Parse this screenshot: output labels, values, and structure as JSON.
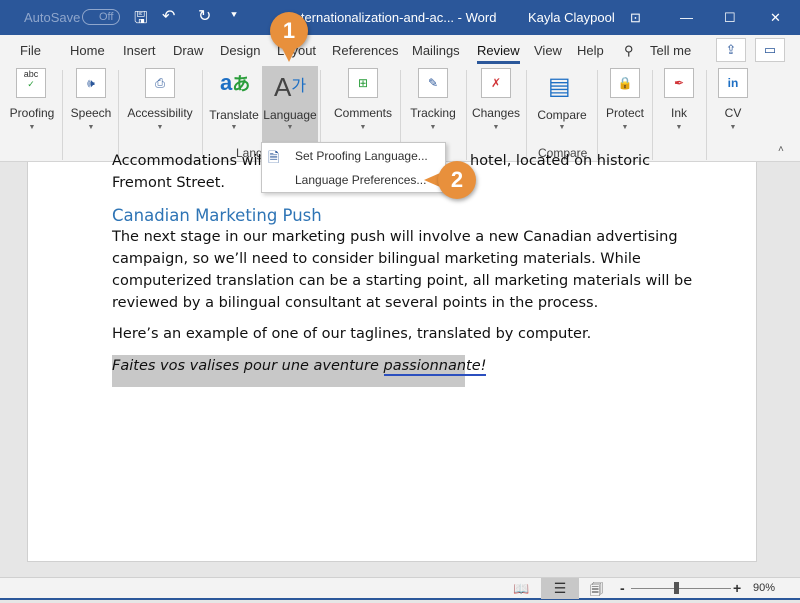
{
  "titlebar": {
    "autosave": "AutoSave",
    "toggle": "Off",
    "doc_title": "Internationalization-and-ac... - Word",
    "user": "Kayla Claypool"
  },
  "tabs": [
    "File",
    "Home",
    "Insert",
    "Draw",
    "Design",
    "Layout",
    "References",
    "Mailings",
    "Review",
    "View",
    "Help"
  ],
  "active_tab": "Review",
  "tell_me": "Tell me",
  "ribbon": {
    "buttons": [
      "Proofing",
      "Speech",
      "Accessibility",
      "Translate",
      "Language",
      "Comments",
      "Tracking",
      "Changes",
      "Compare",
      "Protect",
      "Ink",
      "CV"
    ],
    "groups": {
      "language": "Language",
      "compare": "Compare"
    }
  },
  "menu": {
    "items": [
      "Set Proofing Language...",
      "Language Preferences..."
    ]
  },
  "callouts": [
    "1",
    "2"
  ],
  "document": {
    "line0_left": "Accommodations will",
    "line0_right": "hotel, located on historic",
    "line1": "Fremont Street.",
    "heading": "Canadian Marketing Push",
    "para": [
      "The next stage in our marketing push will involve a new Canadian advertising",
      "campaign, so we’ll need to consider bilingual marketing materials. While",
      "computerized translation can be a starting point, all marketing materials will be",
      "reviewed by a bilingual consultant at several points in the process."
    ],
    "para2": "Here’s an example of one of our taglines, translated by computer.",
    "tagline_a": "Faites vos valises pour une aventure ",
    "tagline_b": "passionnante!"
  },
  "status": {
    "zoom": "90%",
    "zoom_minus": "-",
    "zoom_plus": "+"
  },
  "colors": {
    "titlebar": "#2b579a",
    "heading": "#2e74b5",
    "callout": "#e8903c",
    "highlight": "#c8c8c8"
  }
}
